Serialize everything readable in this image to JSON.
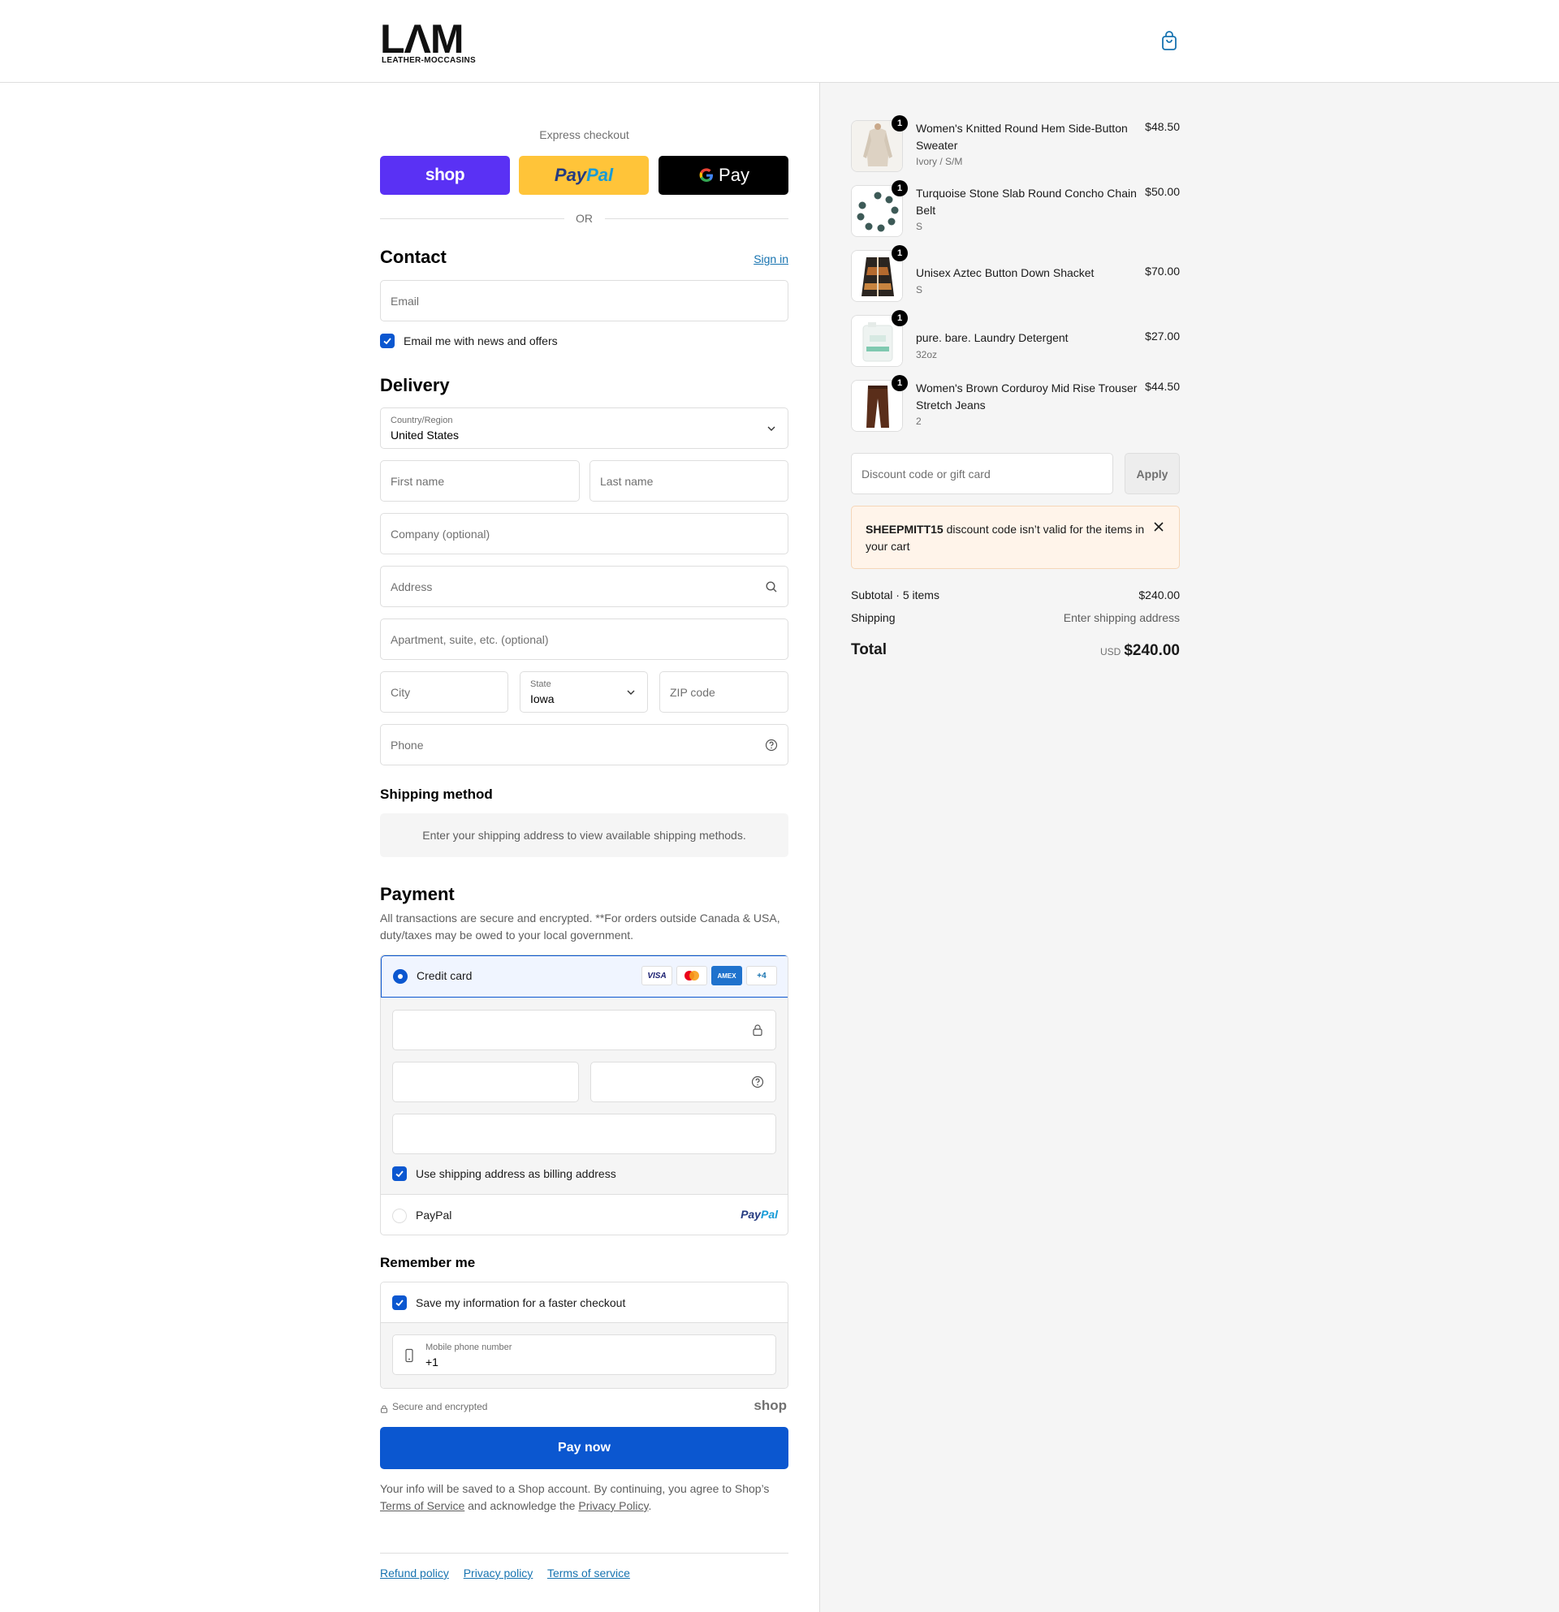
{
  "header": {
    "logo_big": "LΛM",
    "logo_small": "LEATHER-MOCCASINS"
  },
  "express": {
    "title": "Express checkout",
    "shop_label": "shop",
    "paypal_label_1": "Pay",
    "paypal_label_2": "Pal",
    "gpay_label": "Pay",
    "or": "OR"
  },
  "contact": {
    "title": "Contact",
    "sign_in": "Sign in",
    "email_placeholder": "Email",
    "news_label": "Email me with news and offers"
  },
  "delivery": {
    "title": "Delivery",
    "country_label": "Country/Region",
    "country_value": "United States",
    "first_name": "First name",
    "last_name": "Last name",
    "company": "Company (optional)",
    "address": "Address",
    "apartment": "Apartment, suite, etc. (optional)",
    "city": "City",
    "state_label": "State",
    "state_value": "Iowa",
    "zip": "ZIP code",
    "phone": "Phone"
  },
  "shipping": {
    "title": "Shipping method",
    "message": "Enter your shipping address to view available shipping methods."
  },
  "payment": {
    "title": "Payment",
    "description": "All transactions are secure and encrypted. **For orders outside Canada & USA, duty/taxes may be owed to your local government.",
    "credit_card": "Credit card",
    "cards": [
      "VISA",
      "AMEX",
      "+4"
    ],
    "billing_label": "Use shipping address as billing address",
    "paypal": "PayPal",
    "paypal_logo_1": "Pay",
    "paypal_logo_2": "Pal"
  },
  "remember": {
    "title": "Remember me",
    "save_label": "Save my information for a faster checkout",
    "mobile_label": "Mobile phone number",
    "mobile_value": "+1"
  },
  "secure": {
    "text": "Secure and encrypted",
    "shop_logo": "shop"
  },
  "pay_now": "Pay now",
  "legal": {
    "text_1": "Your info will be saved to a Shop account. By continuing, you agree to Shop’s",
    "terms": "Terms of Service",
    "text_2": "and acknowledge the",
    "privacy": "Privacy Policy",
    "text_3": "."
  },
  "footer": {
    "refund": "Refund policy",
    "privacy": "Privacy policy",
    "terms": "Terms of service"
  },
  "cart": {
    "items": [
      {
        "qty": "1",
        "name": "Women's Knitted Round Hem Side-Button Sweater",
        "variant": "Ivory / S/M",
        "price": "$48.50"
      },
      {
        "qty": "1",
        "name": "Turquoise Stone Slab Round Concho Chain Belt",
        "variant": "S",
        "price": "$50.00"
      },
      {
        "qty": "1",
        "name": "Unisex Aztec Button Down Shacket",
        "variant": "S",
        "price": "$70.00"
      },
      {
        "qty": "1",
        "name": "pure. bare. Laundry Detergent",
        "variant": "32oz",
        "price": "$27.00"
      },
      {
        "qty": "1",
        "name": "Women's Brown Corduroy Mid Rise Trouser Stretch Jeans",
        "variant": "2",
        "price": "$44.50"
      }
    ],
    "discount_placeholder": "Discount code or gift card",
    "apply": "Apply",
    "alert_code": "SHEEPMITT15",
    "alert_message": " discount code isn’t valid for the items in your cart",
    "subtotal_label": "Subtotal · 5 items",
    "subtotal_value": "$240.00",
    "shipping_label": "Shipping",
    "shipping_value": "Enter shipping address",
    "total_label": "Total",
    "total_currency": "USD",
    "total_value": "$240.00"
  },
  "colors": {
    "accent": "#0b57d0",
    "shop_purple": "#5a31f4",
    "paypal_yellow": "#ffc439",
    "link": "#1773b0",
    "sidebar_bg": "#f5f5f5",
    "alert_bg": "#fff4ea"
  }
}
